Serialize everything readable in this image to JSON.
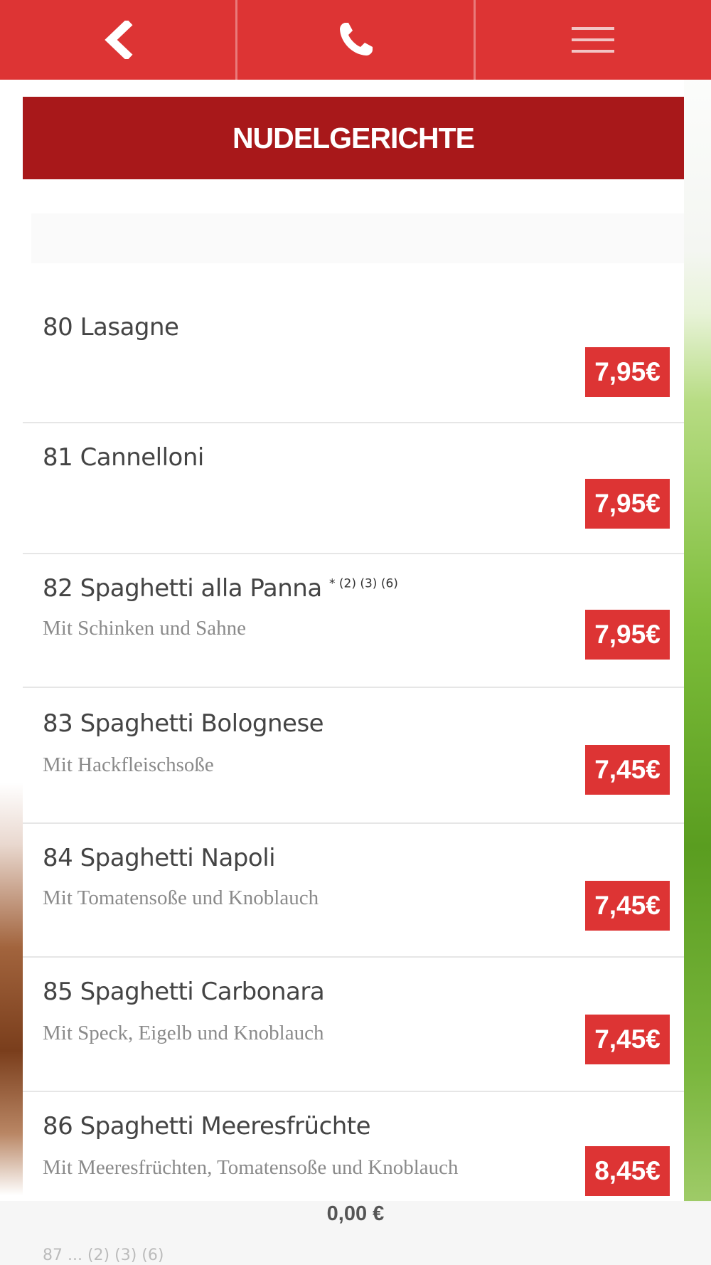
{
  "colors": {
    "nav_red": "#dd3434",
    "category_red": "#a8181a",
    "price_red": "#dd3434"
  },
  "nav": {
    "back_icon": "chevron-left-icon",
    "phone_icon": "phone-icon",
    "menu_icon": "hamburger-menu-icon"
  },
  "category": {
    "title": "NUDELGERICHTE"
  },
  "items": [
    {
      "name": "80 Lasagne",
      "sup": "",
      "desc": "",
      "price": "7,95€"
    },
    {
      "name": "81 Cannelloni",
      "sup": "",
      "desc": "",
      "price": "7,95€"
    },
    {
      "name": "82 Spaghetti alla Panna",
      "sup": "* (2) (3) (6)",
      "desc": "Mit Schinken und Sahne",
      "price": "7,95€"
    },
    {
      "name": "83 Spaghetti Bolognese",
      "sup": "",
      "desc": "Mit Hackfleischsoße",
      "price": "7,45€"
    },
    {
      "name": "84 Spaghetti Napoli",
      "sup": "",
      "desc": "Mit Tomatensoße und Knoblauch",
      "price": "7,45€"
    },
    {
      "name": "85 Spaghetti Carbonara",
      "sup": "",
      "desc": "Mit Speck, Eigelb und Knoblauch",
      "price": "7,45€"
    },
    {
      "name": "86 Spaghetti Meeresfrüchte",
      "sup": "",
      "desc": "Mit Meeresfrüchten, Tomatensoße und Knoblauch",
      "price": "8,45€"
    }
  ],
  "cart": {
    "total": "0,00 €"
  },
  "peek": {
    "text": "87 ... (2) (3) (6)"
  }
}
